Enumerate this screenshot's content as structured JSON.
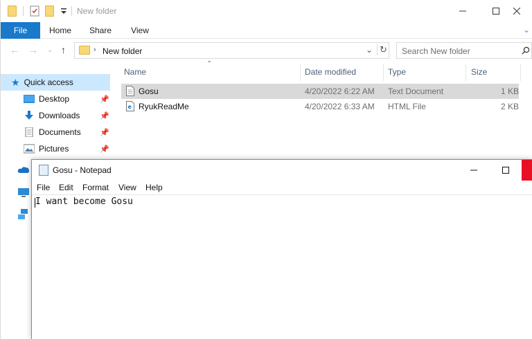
{
  "explorer": {
    "title": "New folder",
    "ribbon": {
      "file": "File",
      "home": "Home",
      "share": "Share",
      "view": "View"
    },
    "address": {
      "path": "New folder",
      "search_placeholder": "Search New folder"
    },
    "sidebar": {
      "quick_access": "Quick access",
      "items": [
        {
          "label": "Desktop"
        },
        {
          "label": "Downloads"
        },
        {
          "label": "Documents"
        },
        {
          "label": "Pictures"
        }
      ]
    },
    "columns": {
      "name": "Name",
      "date": "Date modified",
      "type": "Type",
      "size": "Size"
    },
    "files": [
      {
        "name": "Gosu",
        "date": "4/20/2022 6:22 AM",
        "type": "Text Document",
        "size": "1 KB",
        "selected": true
      },
      {
        "name": "RyukReadMe",
        "date": "4/20/2022 6:33 AM",
        "type": "HTML File",
        "size": "2 KB",
        "selected": false
      }
    ]
  },
  "notepad": {
    "title": "Gosu - Notepad",
    "menu": {
      "file": "File",
      "edit": "Edit",
      "format": "Format",
      "view": "View",
      "help": "Help"
    },
    "content": "I want become Gosu"
  },
  "colors": {
    "accent": "#1979ca",
    "selection": "#cce8ff",
    "close_red": "#e81123",
    "folder": "#f8d775"
  }
}
